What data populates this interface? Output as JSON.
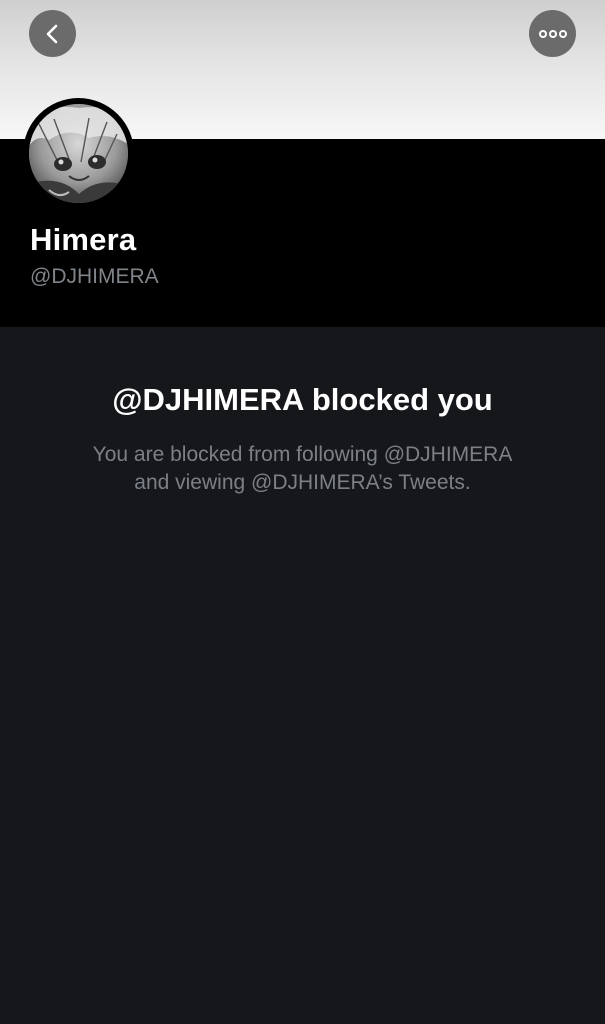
{
  "header": {
    "back_icon": "chevron-left-icon",
    "more_icon": "more-horizontal-icon"
  },
  "profile": {
    "display_name": "Himera",
    "handle": "@DJHIMERA"
  },
  "blocked": {
    "title": "@DJHIMERA blocked you",
    "description_line1": "You are blocked from following @DJHIMERA",
    "description_line2": "and viewing @DJHIMERA’s Tweets."
  },
  "colors": {
    "background": "#16171b",
    "header_black": "#000000",
    "button_gray": "#6b6b6b",
    "muted_text": "#7b8087"
  }
}
